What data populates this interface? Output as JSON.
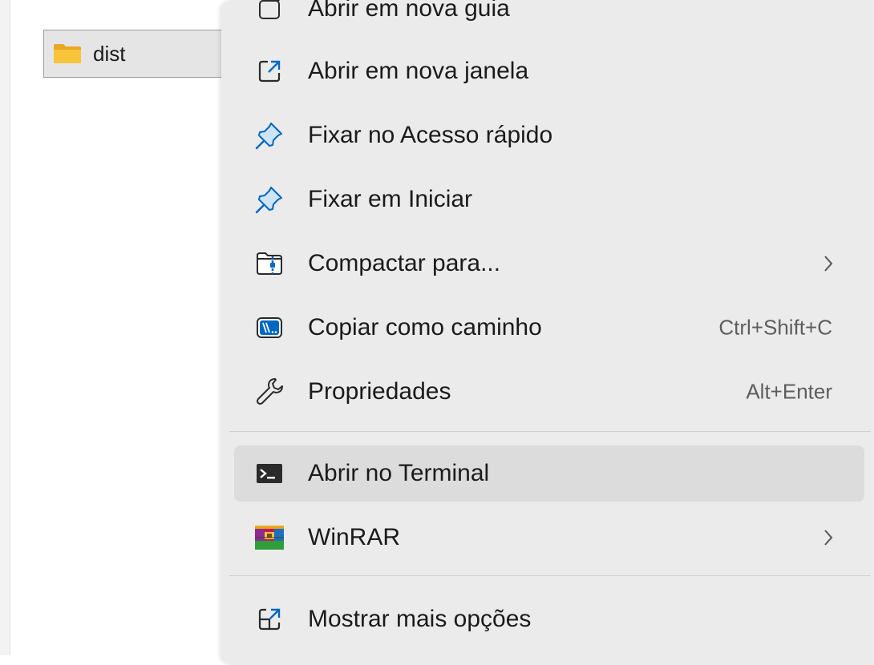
{
  "explorer": {
    "folder": {
      "name": "dist",
      "icon": "folder-icon",
      "color": "#f8c43a"
    }
  },
  "context_menu": {
    "items": [
      {
        "label": "Abrir em nova guia",
        "icon": "new-tab-icon",
        "shortcut": "",
        "submenu": false
      },
      {
        "label": "Abrir em nova janela",
        "icon": "open-new-window-icon",
        "shortcut": "",
        "submenu": false
      },
      {
        "label": "Fixar no Acesso rápido",
        "icon": "pin-icon",
        "shortcut": "",
        "submenu": false
      },
      {
        "label": "Fixar em Iniciar",
        "icon": "pin-icon",
        "shortcut": "",
        "submenu": false
      },
      {
        "label": "Compactar para...",
        "icon": "zip-folder-icon",
        "shortcut": "",
        "submenu": true
      },
      {
        "label": "Copiar como caminho",
        "icon": "copy-path-icon",
        "shortcut": "Ctrl+Shift+C",
        "submenu": false
      },
      {
        "label": "Propriedades",
        "icon": "wrench-icon",
        "shortcut": "Alt+Enter",
        "submenu": false
      },
      {
        "label": "Abrir no Terminal",
        "icon": "terminal-icon",
        "shortcut": "",
        "submenu": false,
        "highlighted": true
      },
      {
        "label": "WinRAR",
        "icon": "winrar-icon",
        "shortcut": "",
        "submenu": true
      },
      {
        "label": "Mostrar mais opções",
        "icon": "show-more-options-icon",
        "shortcut": "",
        "submenu": false
      }
    ],
    "colors": {
      "background": "#ebebeb",
      "highlight": "#dcdcdc",
      "accent": "#0067c0",
      "text": "#1b1b1b",
      "shortcut_text": "#5d5d5d"
    }
  }
}
